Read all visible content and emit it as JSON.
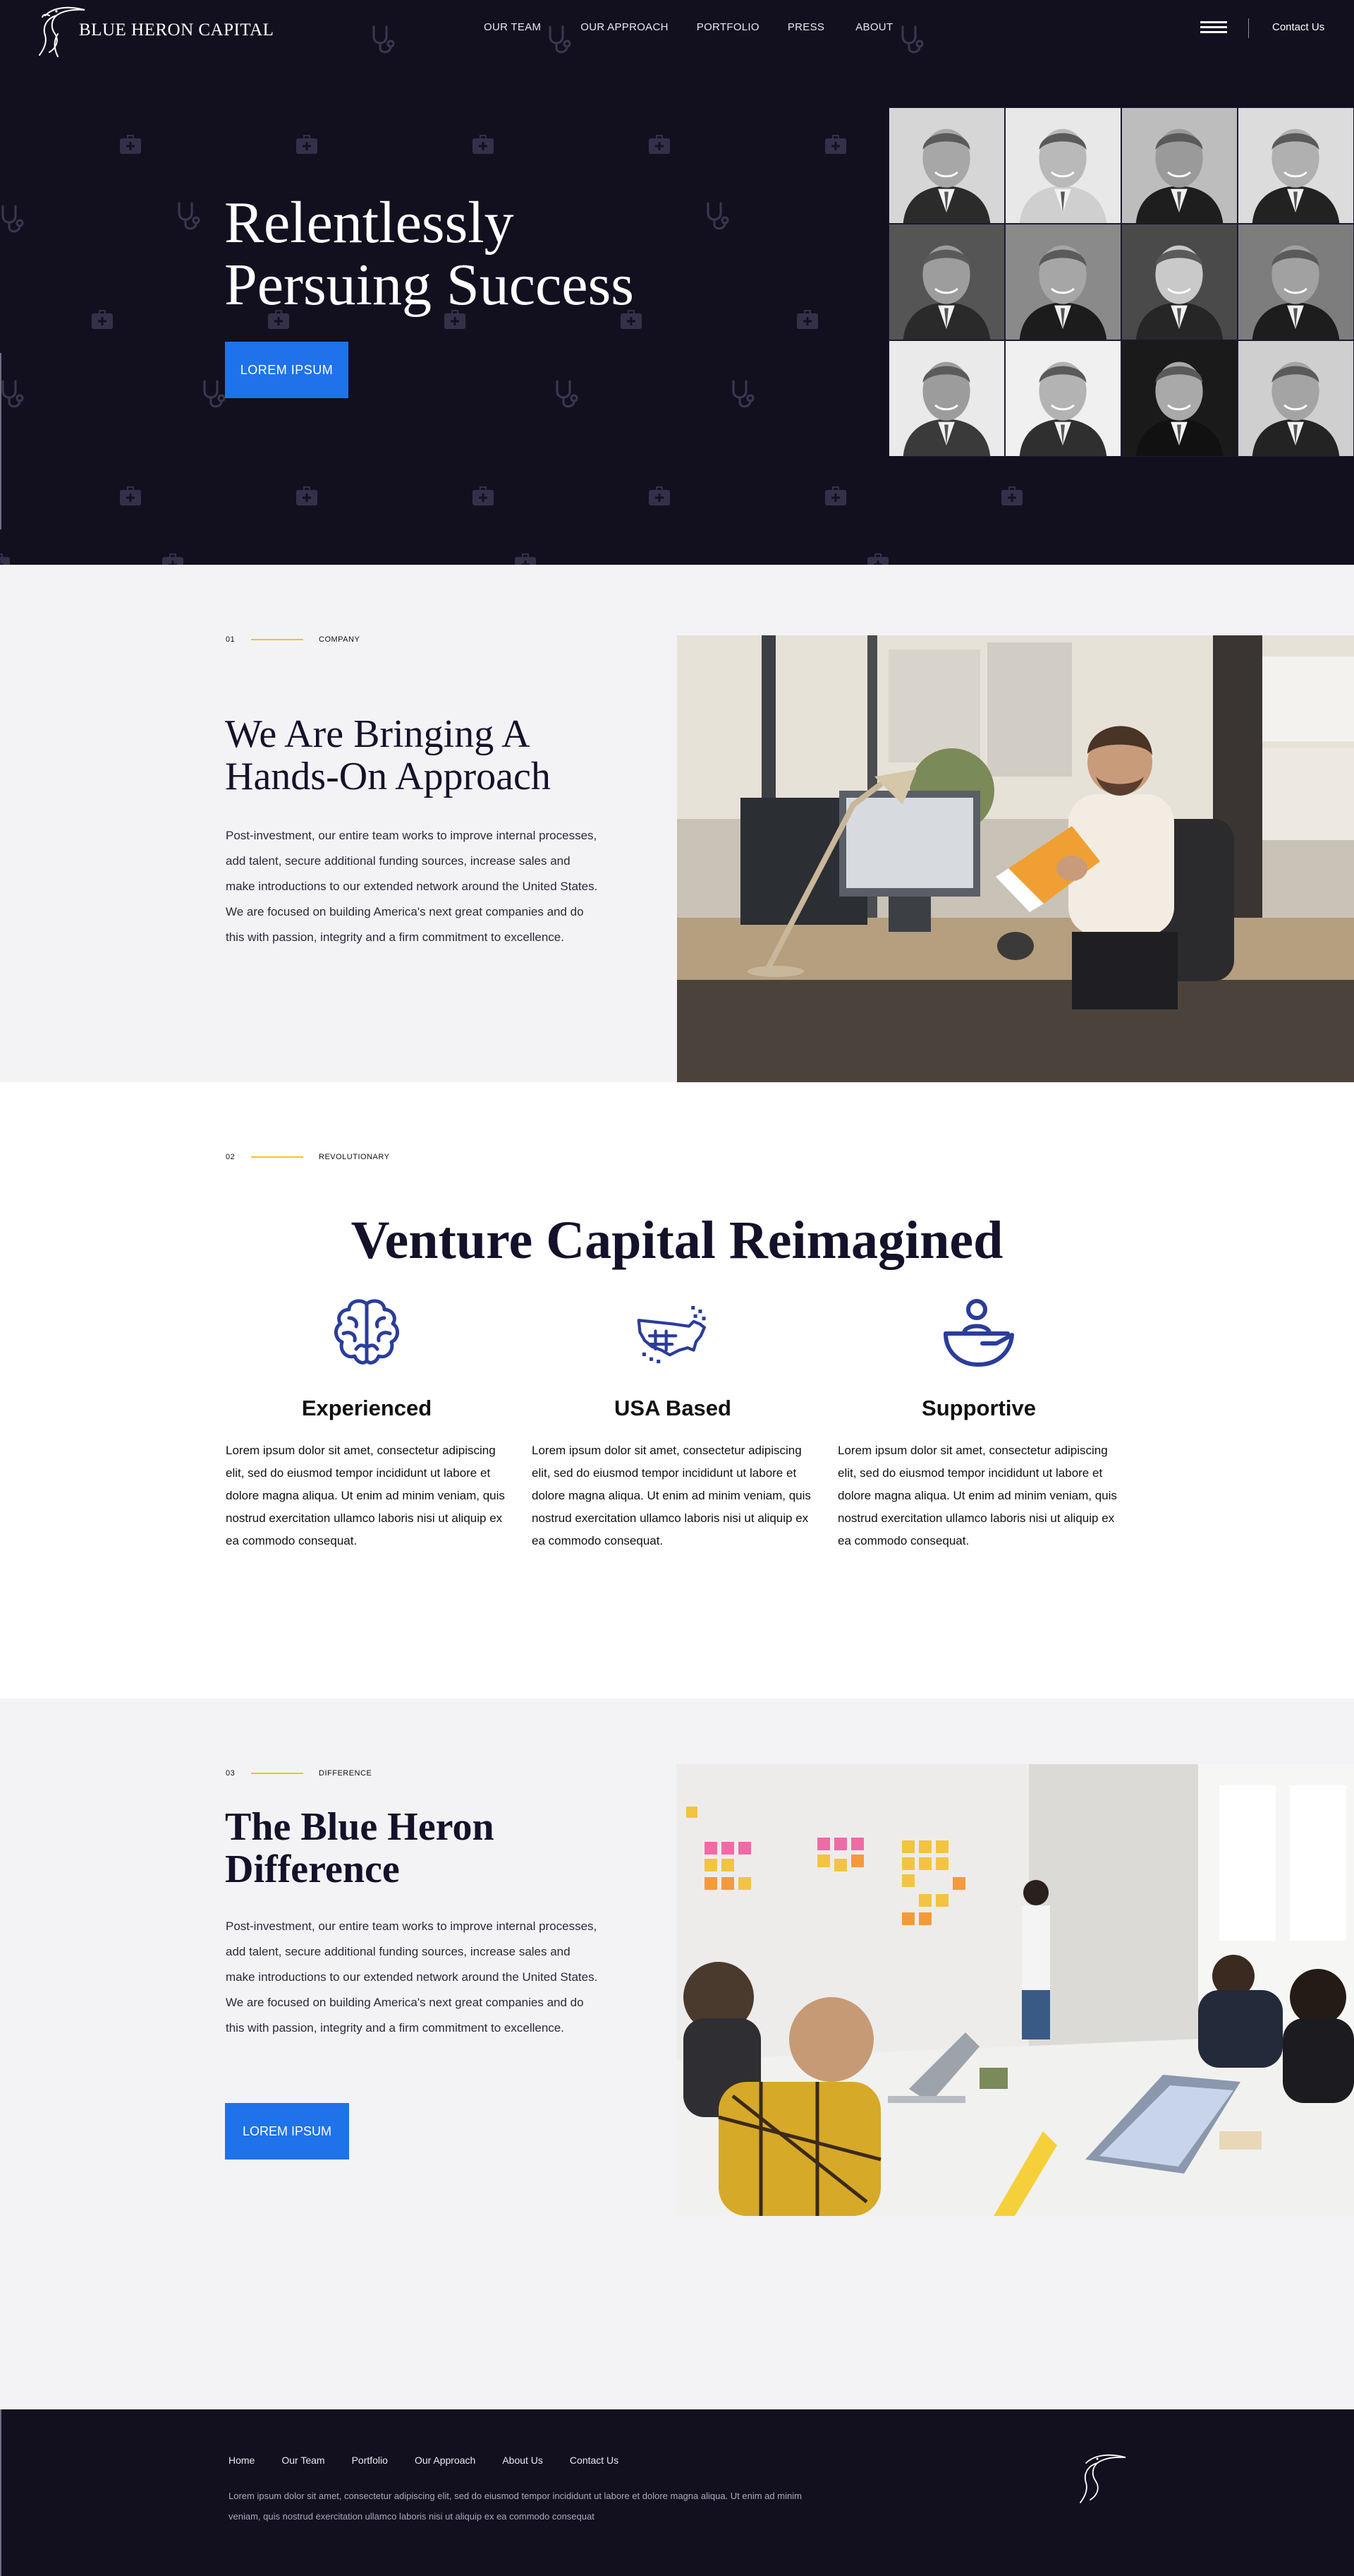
{
  "brand": {
    "name": "BLUE HERON CAPITAL"
  },
  "nav": {
    "items": [
      "OUR TEAM",
      "OUR APPROACH",
      "PORTFOLIO",
      "PRESS",
      "ABOUT"
    ],
    "contact": "Contact Us",
    "menu_icon": "hamburger-icon"
  },
  "hero": {
    "title_line1": "Relentlessly",
    "title_line2": "Persuing Success",
    "cta": "LOREM IPSUM",
    "pattern_icons": [
      "stethoscope-icon",
      "medical-kit-icon"
    ]
  },
  "section1": {
    "number": "01",
    "tag": "COMPANY",
    "title_line1": "We Are Bringing A",
    "title_line2": "Hands-On Approach",
    "body": "Post-investment, our entire team works to improve internal processes, add talent, secure additional funding sources, increase sales and make introductions to our extended network around the United States. We are focused on building America's next great companies and do this with passion, integrity and a firm commitment to excellence."
  },
  "section2": {
    "number": "02",
    "tag": "REVOLUTIONARY",
    "title": "Venture Capital Reimagined",
    "features": [
      {
        "icon": "brain-icon",
        "title": "Experienced",
        "text": "Lorem ipsum dolor sit amet, consectetur adipiscing elit, sed do eiusmod tempor incididunt ut labore et dolore magna aliqua. Ut enim ad minim veniam, quis nostrud exercitation ullamco laboris nisi ut aliquip ex ea commodo consequat."
      },
      {
        "icon": "usa-map-icon",
        "title": "USA Based",
        "text": "Lorem ipsum dolor sit amet, consectetur adipiscing elit, sed do eiusmod tempor incididunt ut labore et dolore magna aliqua. Ut enim ad minim veniam, quis nostrud exercitation ullamco laboris nisi ut aliquip ex ea commodo consequat."
      },
      {
        "icon": "supportive-hand-icon",
        "title": "Supportive",
        "text": "Lorem ipsum dolor sit amet, consectetur adipiscing elit, sed do eiusmod tempor incididunt ut labore et dolore magna aliqua. Ut enim ad minim veniam, quis nostrud exercitation ullamco laboris nisi ut aliquip ex ea commodo consequat."
      }
    ]
  },
  "section3": {
    "number": "03",
    "tag": "DIFFERENCE",
    "title_line1": "The Blue Heron",
    "title_line2": "Difference",
    "body": "Post-investment, our entire team works to improve internal processes, add talent, secure additional funding sources, increase sales and make introductions to our extended network around the United States. We are focused on building America's next great companies and do this with passion, integrity and a firm commitment to excellence.",
    "cta": "LOREM IPSUM"
  },
  "footer": {
    "links": [
      "Home",
      "Our Team",
      "Portfolio",
      "Our Approach",
      "About Us",
      "Contact Us"
    ],
    "text": "Lorem ipsum dolor sit amet, consectetur adipiscing elit, sed do eiusmod tempor incididunt ut labore et dolore magna aliqua. Ut enim ad minim veniam, quis nostrud exercitation ullamco laboris nisi ut aliquip ex ea commodo consequat"
  },
  "colors": {
    "navy": "#12101f",
    "accent_blue": "#1f72ea",
    "icon_blue": "#2a3d9a",
    "accent_yellow": "#f5c31c",
    "light_bg": "#f3f3f6"
  }
}
